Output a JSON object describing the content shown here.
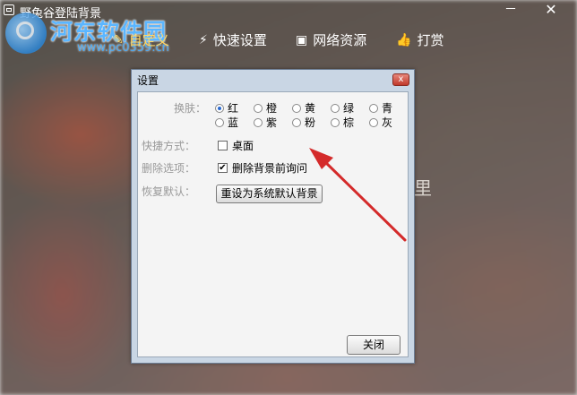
{
  "app": {
    "title": "野兔谷登陆背景",
    "minimize": "－",
    "close": "✕"
  },
  "nav": [
    {
      "label": "自定义",
      "icon": "✎"
    },
    {
      "label": "快速设置",
      "icon": "⚡"
    },
    {
      "label": "网络资源",
      "icon": "▣"
    },
    {
      "label": "打赏",
      "icon": "👍"
    }
  ],
  "watermark": {
    "text": "河东软件园",
    "url": "www.pc0359.cn"
  },
  "background_char": "里",
  "dialog": {
    "title": "设置",
    "close": "x",
    "skin_label": "换肤：",
    "skins": [
      "红",
      "橙",
      "黄",
      "绿",
      "青",
      "蓝",
      "紫",
      "粉",
      "棕",
      "灰"
    ],
    "skin_selected": "红",
    "shortcut_label": "快捷方式：",
    "shortcut_option": "桌面",
    "shortcut_checked": false,
    "delete_label": "删除选项：",
    "delete_option": "删除背景前询问",
    "delete_checked": true,
    "reset_label": "恢复默认：",
    "reset_button": "重设为系统默认背景",
    "close_button": "关闭"
  },
  "colors": {
    "accent": "#ffd866",
    "arrow": "#d42a2a",
    "dialog_frame": "#c9d6e4"
  }
}
